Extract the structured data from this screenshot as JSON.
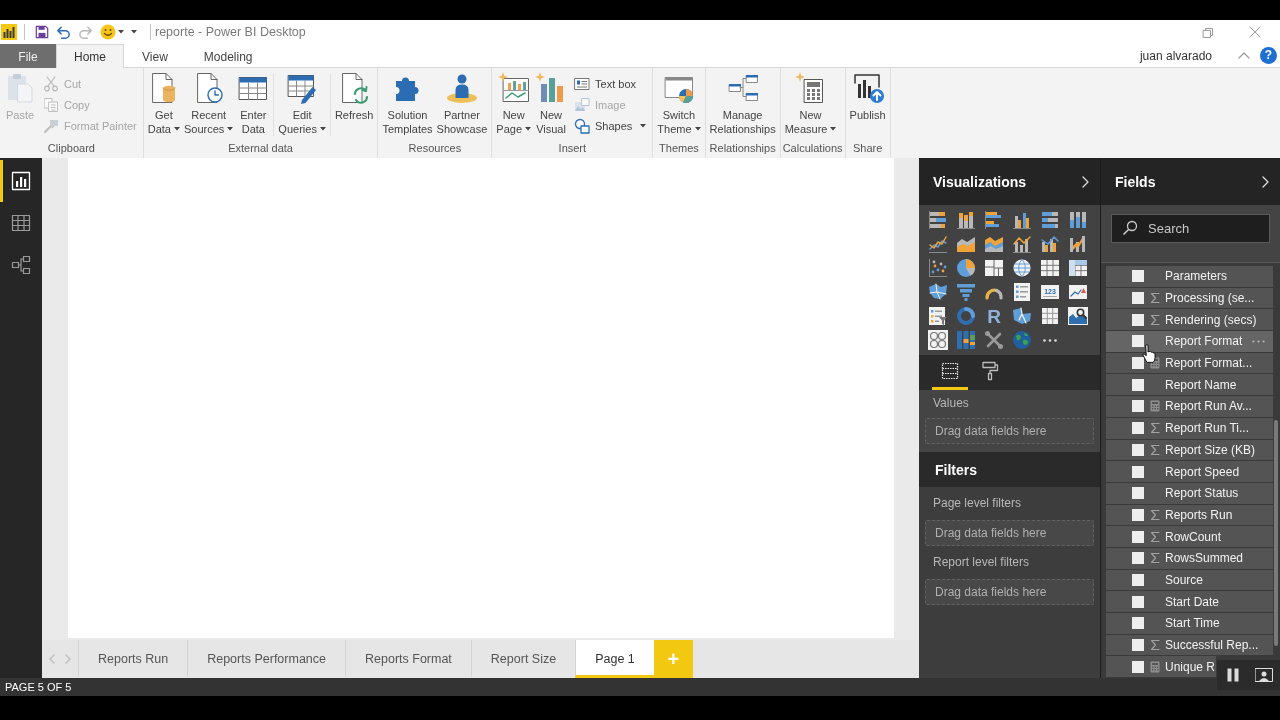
{
  "titlebar": {
    "title": "reporte - Power BI Desktop",
    "quick_access": [
      {
        "kind": "save",
        "disabled": false
      },
      {
        "kind": "undo",
        "disabled": false
      },
      {
        "kind": "redo",
        "disabled": true
      },
      {
        "kind": "emoji",
        "disabled": false
      },
      {
        "kind": "customize",
        "disabled": false
      }
    ]
  },
  "ribbon": {
    "tabs": [
      {
        "label": "File",
        "kind": "backstage",
        "selected": false
      },
      {
        "label": "Home",
        "kind": "tab",
        "selected": true
      },
      {
        "label": "View",
        "kind": "tab",
        "selected": false
      },
      {
        "label": "Modeling",
        "kind": "tab",
        "selected": false
      }
    ],
    "user": "juan alvarado",
    "help": "?",
    "groups": [
      {
        "label": "Clipboard",
        "sections": [
          {
            "items": [
              {
                "kind": "paste",
                "lines": [
                  "Paste"
                ],
                "dropdown": false,
                "disabled": true
              },
              {
                "stack": [
                  {
                    "kind": "cut",
                    "lines": [
                      "Cut"
                    ],
                    "dropdown": false,
                    "disabled": true
                  },
                  {
                    "kind": "copy",
                    "lines": [
                      "Copy"
                    ],
                    "dropdown": false,
                    "disabled": true
                  },
                  {
                    "kind": "painter",
                    "lines": [
                      "Format Painter"
                    ],
                    "dropdown": false,
                    "disabled": true
                  }
                ]
              }
            ]
          }
        ]
      },
      {
        "label": "External data",
        "sections": [
          {
            "items": [
              {
                "kind": "getdata",
                "lines": [
                  "Get",
                  "Data"
                ],
                "dropdown": true,
                "disabled": false
              },
              {
                "kind": "recent",
                "lines": [
                  "Recent",
                  "Sources"
                ],
                "dropdown": true,
                "disabled": false
              },
              {
                "kind": "enterdata",
                "lines": [
                  "Enter",
                  "Data"
                ],
                "dropdown": false,
                "disabled": false
              }
            ]
          },
          {
            "items": [
              {
                "kind": "queries",
                "lines": [
                  "Edit",
                  "Queries"
                ],
                "dropdown": true,
                "disabled": false
              }
            ]
          },
          {
            "items": [
              {
                "kind": "refresh",
                "lines": [
                  "Refresh"
                ],
                "dropdown": false,
                "disabled": false
              }
            ]
          }
        ]
      },
      {
        "label": "Resources",
        "sections": [
          {
            "items": [
              {
                "kind": "templates",
                "lines": [
                  "Solution",
                  "Templates"
                ],
                "dropdown": false,
                "disabled": false
              },
              {
                "kind": "showcase",
                "lines": [
                  "Partner",
                  "Showcase"
                ],
                "dropdown": false,
                "disabled": false
              }
            ]
          }
        ]
      },
      {
        "label": "Insert",
        "sections": [
          {
            "items": [
              {
                "kind": "newpage",
                "lines": [
                  "New",
                  "Page"
                ],
                "dropdown": true,
                "disabled": false
              },
              {
                "kind": "newvisual",
                "lines": [
                  "New",
                  "Visual"
                ],
                "dropdown": false,
                "disabled": false
              },
              {
                "stack": [
                  {
                    "kind": "textbox",
                    "lines": [
                      "Text box"
                    ],
                    "dropdown": false,
                    "disabled": false
                  },
                  {
                    "kind": "image",
                    "lines": [
                      "Image"
                    ],
                    "dropdown": false,
                    "disabled": true
                  },
                  {
                    "kind": "shapes",
                    "lines": [
                      "Shapes"
                    ],
                    "dropdown": true,
                    "disabled": false
                  }
                ]
              }
            ]
          }
        ]
      },
      {
        "label": "Themes",
        "sections": [
          {
            "items": [
              {
                "kind": "theme",
                "lines": [
                  "Switch",
                  "Theme"
                ],
                "dropdown": true,
                "disabled": false
              }
            ]
          }
        ]
      },
      {
        "label": "Relationships",
        "sections": [
          {
            "items": [
              {
                "kind": "relationships",
                "lines": [
                  "Manage",
                  "Relationships"
                ],
                "dropdown": false,
                "disabled": false
              }
            ]
          }
        ]
      },
      {
        "label": "Calculations",
        "sections": [
          {
            "items": [
              {
                "kind": "measure",
                "lines": [
                  "New",
                  "Measure"
                ],
                "dropdown": true,
                "disabled": false
              }
            ]
          }
        ]
      },
      {
        "label": "Share",
        "sections": [
          {
            "items": [
              {
                "kind": "publish",
                "lines": [
                  "Publish"
                ],
                "dropdown": false,
                "disabled": false
              }
            ]
          }
        ]
      }
    ]
  },
  "views": [
    {
      "kind": "report",
      "selected": true
    },
    {
      "kind": "data",
      "selected": false
    },
    {
      "kind": "model",
      "selected": false
    }
  ],
  "pages": {
    "tabs": [
      {
        "label": "Reports Run",
        "selected": false
      },
      {
        "label": "Reports Performance",
        "selected": false
      },
      {
        "label": "Reports Format",
        "selected": false
      },
      {
        "label": "Report Size",
        "selected": false
      },
      {
        "label": "Page 1",
        "selected": true
      }
    ],
    "add": "+"
  },
  "visualizations": {
    "title": "Visualizations",
    "gallery": [
      {
        "kind": "stackedbar"
      },
      {
        "kind": "stackedcolumn"
      },
      {
        "kind": "clusteredbar"
      },
      {
        "kind": "clusteredcolumn"
      },
      {
        "kind": "fullbar"
      },
      {
        "kind": "fullcolumn"
      },
      {
        "kind": "line"
      },
      {
        "kind": "area"
      },
      {
        "kind": "stackedarea"
      },
      {
        "kind": "linecolumn"
      },
      {
        "kind": "lineclustered"
      },
      {
        "kind": "ribbon"
      },
      {
        "kind": "scatter"
      },
      {
        "kind": "pie"
      },
      {
        "kind": "treemap"
      },
      {
        "kind": "map"
      },
      {
        "kind": "table"
      },
      {
        "kind": "matrix"
      },
      {
        "kind": "filledmap"
      },
      {
        "kind": "funnel"
      },
      {
        "kind": "gauge"
      },
      {
        "kind": "multicard"
      },
      {
        "kind": "card",
        "glyph": "123"
      },
      {
        "kind": "kpi"
      },
      {
        "kind": "slicer"
      },
      {
        "kind": "donut"
      },
      {
        "kind": "rscript",
        "glyph": "R"
      },
      {
        "kind": "shapemap"
      },
      {
        "kind": "grid"
      },
      {
        "kind": "searchchart"
      },
      {
        "kind": "circlegrid"
      },
      {
        "kind": "tallcolumns"
      },
      {
        "kind": "tools"
      },
      {
        "kind": "globe"
      },
      {
        "kind": "more"
      }
    ],
    "well_tabs": [
      {
        "kind": "fields",
        "selected": true
      },
      {
        "kind": "format",
        "selected": false
      }
    ],
    "values_label": "Values",
    "values_drop": "Drag data fields here"
  },
  "filters": {
    "title": "Filters",
    "sections": [
      {
        "label": "Page level filters",
        "drop": "Drag data fields here"
      },
      {
        "label": "Report level filters",
        "drop": "Drag data fields here"
      }
    ]
  },
  "fields": {
    "title": "Fields",
    "search_placeholder": "Search",
    "items": [
      {
        "name": "Parameters",
        "kind": "plain",
        "checked": false,
        "hovered": false
      },
      {
        "name": "Processing (se...",
        "kind": "sum",
        "checked": false,
        "hovered": false
      },
      {
        "name": "Rendering (secs)",
        "kind": "sum",
        "checked": false,
        "hovered": false
      },
      {
        "name": "Report Format",
        "kind": "plain",
        "checked": false,
        "hovered": true
      },
      {
        "name": "Report Format...",
        "kind": "measure",
        "checked": false,
        "hovered": false
      },
      {
        "name": "Report Name",
        "kind": "plain",
        "checked": false,
        "hovered": false
      },
      {
        "name": "Report Run Av...",
        "kind": "measure",
        "checked": false,
        "hovered": false
      },
      {
        "name": "Report Run Ti...",
        "kind": "sum",
        "checked": false,
        "hovered": false
      },
      {
        "name": "Report Size (KB)",
        "kind": "sum",
        "checked": false,
        "hovered": false
      },
      {
        "name": "Report Speed",
        "kind": "plain",
        "checked": false,
        "hovered": false
      },
      {
        "name": "Report Status",
        "kind": "plain",
        "checked": false,
        "hovered": false
      },
      {
        "name": "Reports Run",
        "kind": "sum",
        "checked": false,
        "hovered": false
      },
      {
        "name": "RowCount",
        "kind": "sum",
        "checked": false,
        "hovered": false
      },
      {
        "name": "RowsSummed",
        "kind": "sum",
        "checked": false,
        "hovered": false
      },
      {
        "name": "Source",
        "kind": "plain",
        "checked": false,
        "hovered": false
      },
      {
        "name": "Start Date",
        "kind": "plain",
        "checked": false,
        "hovered": false
      },
      {
        "name": "Start Time",
        "kind": "plain",
        "checked": false,
        "hovered": false
      },
      {
        "name": "Successful Rep...",
        "kind": "sum",
        "checked": false,
        "hovered": false
      },
      {
        "name": "Unique R",
        "kind": "measure",
        "checked": false,
        "hovered": false
      }
    ]
  },
  "status": "PAGE 5 OF 5"
}
